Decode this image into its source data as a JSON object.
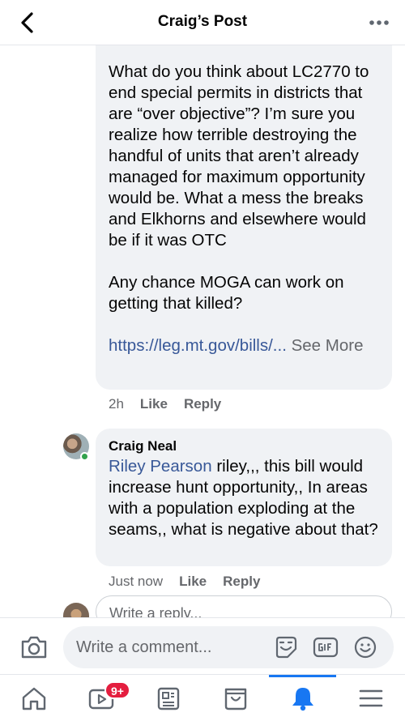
{
  "header": {
    "title": "Craig’s Post"
  },
  "first_comment": {
    "paragraph1": "What do you think about LC2770 to end special permits in districts that are “over objective”? I’m sure you realize how terrible destroying the handful of units that aren’t already managed for maximum opportunity would be. What a mess the breaks and Elkhorns and elsewhere would be if it was OTC",
    "paragraph2": "Any chance MOGA can work on getting that killed?",
    "link_text": "https://leg.mt.gov/bills/...",
    "see_more": "See More",
    "time": "2h",
    "like_label": "Like",
    "reply_label": "Reply"
  },
  "reply_comment": {
    "author": "Craig Neal",
    "mention": "Riley Pearson",
    "text": " riley,,,  this bill would increase hunt opportunity,, In areas with a population exploding at the seams,,  what is negative about that?",
    "time": "Just now",
    "like_label": "Like",
    "reply_label": "Reply"
  },
  "reply_input": {
    "placeholder": "Write a reply..."
  },
  "composer": {
    "placeholder": "Write a comment..."
  },
  "bottom_nav": {
    "video_badge": "9+",
    "active_tab": "notifications"
  },
  "icons": {
    "back": "chevron-left-icon",
    "more": "more-horizontal-icon",
    "camera": "camera-icon",
    "sticker": "sticker-icon",
    "gif": "gif-icon",
    "emoji": "emoji-icon",
    "home": "home-icon",
    "video": "video-icon",
    "news": "news-icon",
    "marketplace": "marketplace-icon",
    "notifications": "bell-icon",
    "menu": "menu-icon"
  },
  "colors": {
    "accent": "#1877f2",
    "link": "#385898",
    "bubble": "#f0f2f5",
    "badge": "#e41e3f",
    "online": "#31a24c"
  }
}
